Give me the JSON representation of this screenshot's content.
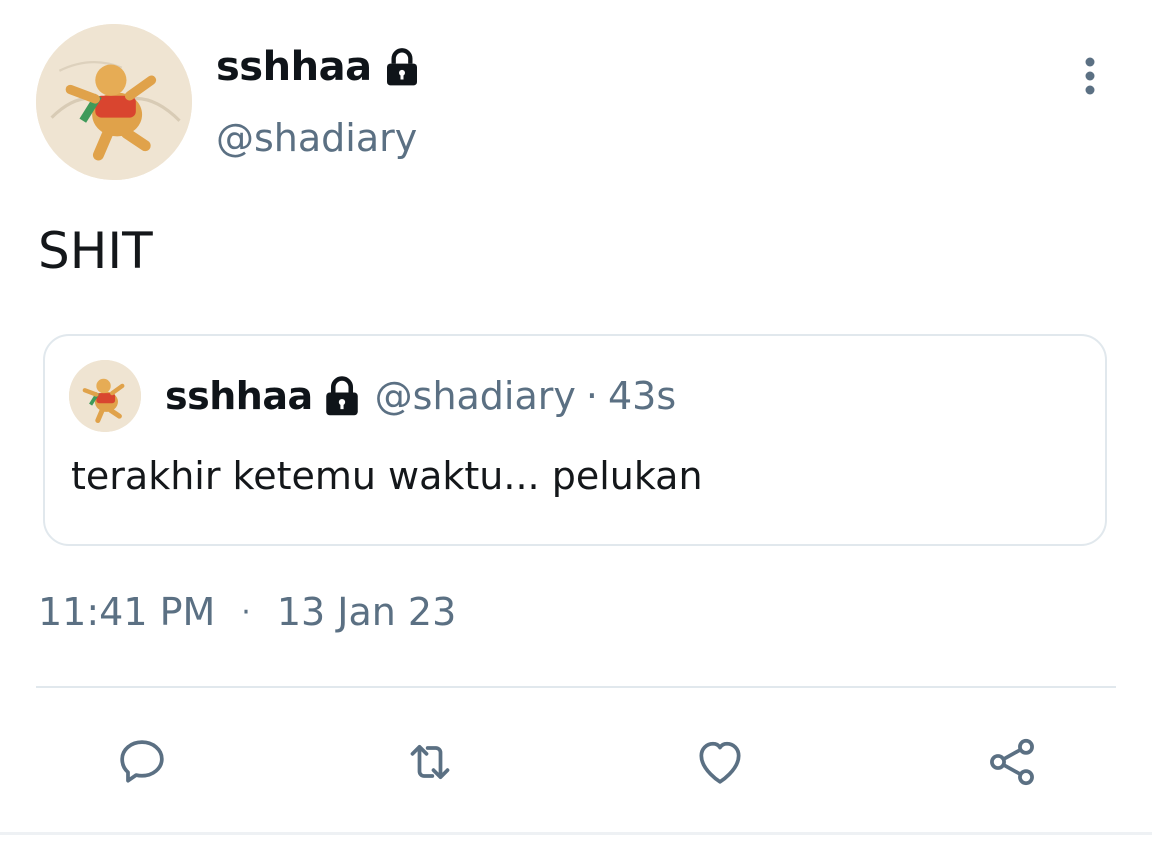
{
  "tweet": {
    "display_name": "sshhaa",
    "handle": "@shadiary",
    "text": "SHIT",
    "time": "11:41 PM",
    "separator": "·",
    "date": "13 Jan 23"
  },
  "quoted_tweet": {
    "display_name": "sshhaa",
    "handle": "@shadiary",
    "separator": "·",
    "time_ago": "43s",
    "text": "terakhir ketemu waktu... pelukan"
  },
  "icons": {
    "lock": "lock-icon",
    "more": "more-vertical-icon",
    "reply": "reply-icon",
    "retweet": "retweet-icon",
    "like": "heart-icon",
    "share": "share-icon"
  },
  "colors": {
    "text_primary": "#0f1419",
    "text_secondary": "#5b7083",
    "border": "#e1e8ed",
    "icon": "#5b7083"
  }
}
